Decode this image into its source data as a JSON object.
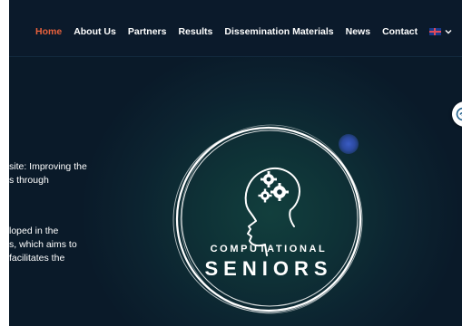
{
  "nav": {
    "items": [
      {
        "label": "Home",
        "active": true
      },
      {
        "label": "About Us",
        "active": false
      },
      {
        "label": "Partners",
        "active": false
      },
      {
        "label": "Results",
        "active": false
      },
      {
        "label": "Dissemination Materials",
        "active": false
      },
      {
        "label": "News",
        "active": false
      },
      {
        "label": "Contact",
        "active": false
      }
    ],
    "language_icon": "uk-flag-icon"
  },
  "hero": {
    "lines": [
      "site: Improving the",
      "s through",
      "loped in the",
      "s, which aims to",
      " facilitates the"
    ]
  },
  "logo": {
    "line1": "COMPUTATIONAL",
    "line2": "SENIORS"
  },
  "colors": {
    "nav_bg": "#0b1a2b",
    "active": "#e8613c",
    "hero_bg": "#0c2330",
    "accent_blue": "#2c4aa0"
  },
  "icons": {
    "language_dropdown": "chevron-down-icon",
    "side_widget": "accessibility-icon"
  }
}
